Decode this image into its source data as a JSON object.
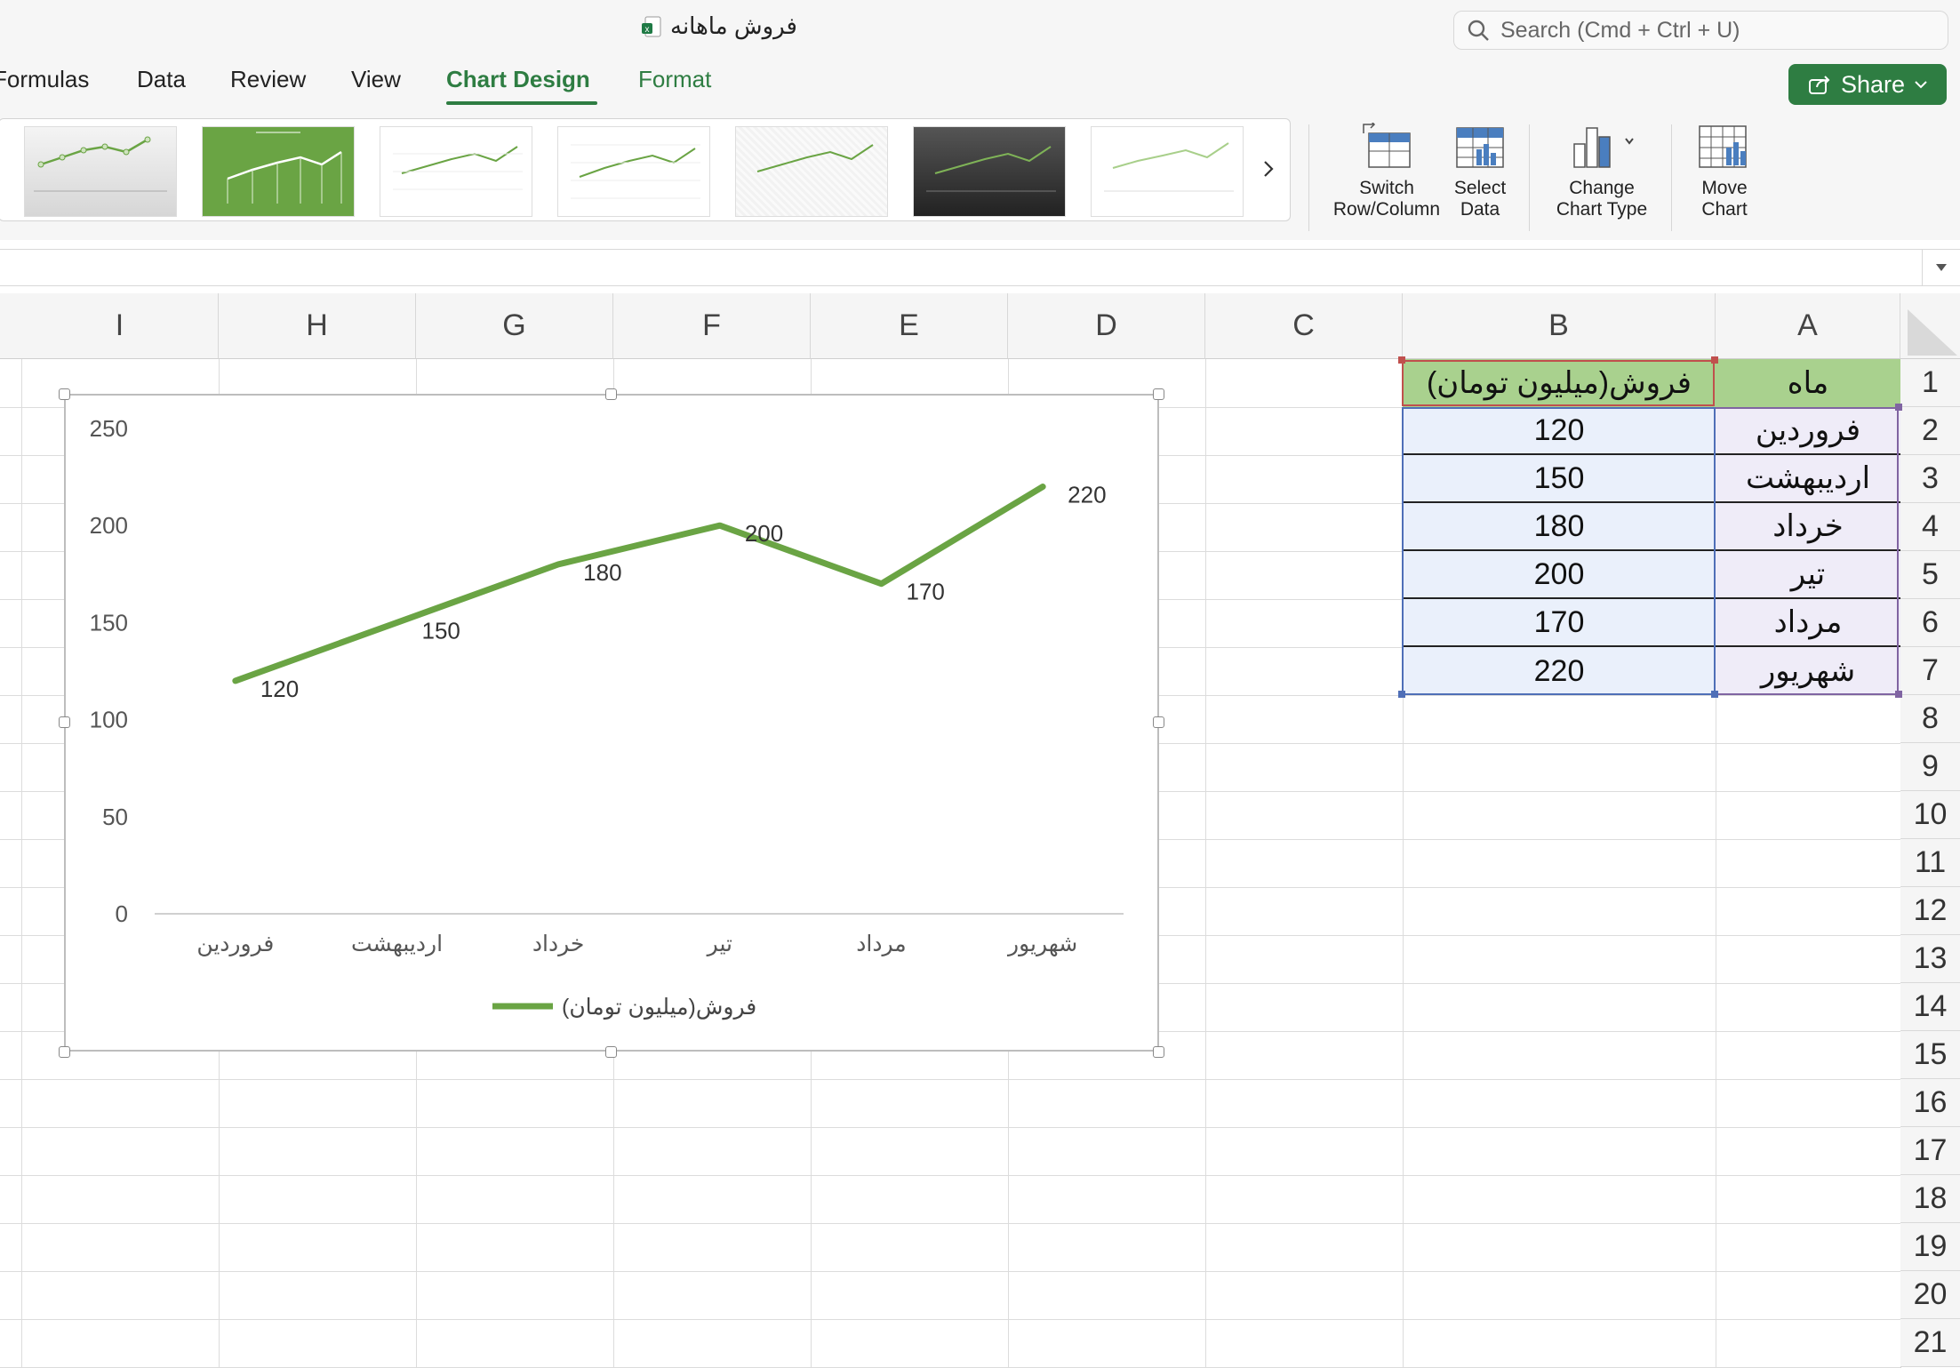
{
  "window": {
    "document_title": "فروش ماهانه"
  },
  "search": {
    "placeholder": "Search (Cmd + Ctrl + U)"
  },
  "tabs": [
    {
      "label": "Formulas",
      "active": false
    },
    {
      "label": "Data",
      "active": false
    },
    {
      "label": "Review",
      "active": false
    },
    {
      "label": "View",
      "active": false
    },
    {
      "label": "Chart Design",
      "active": true
    },
    {
      "label": "Format",
      "active": false
    }
  ],
  "share": {
    "label": "Share"
  },
  "ribbon": {
    "switch_line1": "Switch",
    "switch_line2": "Row/Column",
    "select_line1": "Select",
    "select_line2": "Data",
    "change_line1": "Change",
    "change_line2": "Chart Type",
    "move_line1": "Move",
    "move_line2": "Chart"
  },
  "columns": [
    "I",
    "H",
    "G",
    "F",
    "E",
    "D",
    "C",
    "B",
    "A"
  ],
  "rows": [
    "1",
    "2",
    "3",
    "4",
    "5",
    "6",
    "7",
    "8",
    "9",
    "10",
    "11",
    "12",
    "13",
    "14",
    "15",
    "16",
    "17",
    "18",
    "19",
    "20",
    "21"
  ],
  "table": {
    "header_month": "ماه",
    "header_sales": "فروش(میلیون تومان)",
    "rows": [
      {
        "month": "فروردین",
        "sales": "120"
      },
      {
        "month": "اردیبهشت",
        "sales": "150"
      },
      {
        "month": "خرداد",
        "sales": "180"
      },
      {
        "month": "تیر",
        "sales": "200"
      },
      {
        "month": "مرداد",
        "sales": "170"
      },
      {
        "month": "شهریور",
        "sales": "220"
      }
    ]
  },
  "colors": {
    "accent": "#2e7d42",
    "series": "#6aa444",
    "header_fill": "#a9d18e"
  },
  "chart_data": {
    "type": "line",
    "categories": [
      "فروردین",
      "اردیبهشت",
      "خرداد",
      "تیر",
      "مرداد",
      "شهریور"
    ],
    "series": [
      {
        "name": "فروش(میلیون تومان)",
        "values": [
          120,
          150,
          180,
          200,
          170,
          220
        ]
      }
    ],
    "yticks": [
      "0",
      "50",
      "100",
      "150",
      "200",
      "250"
    ],
    "ylim": [
      0,
      250
    ],
    "grid": false,
    "legend": "bottom",
    "data_labels": true
  }
}
